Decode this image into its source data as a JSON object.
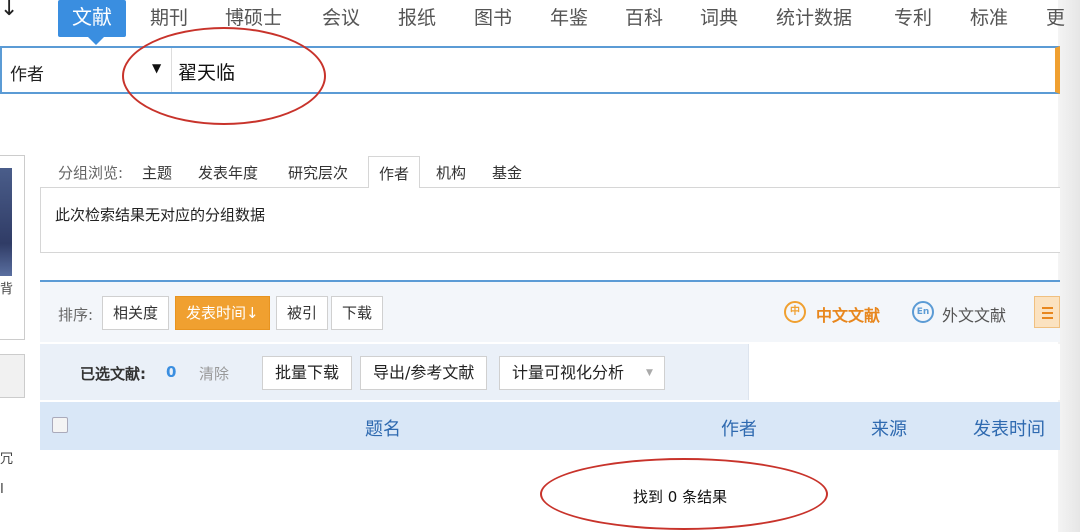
{
  "topnav": {
    "corner": "↓",
    "items": [
      {
        "label": "文献",
        "active": true
      },
      {
        "label": "期刊"
      },
      {
        "label": "博硕士"
      },
      {
        "label": "会议"
      },
      {
        "label": "报纸"
      },
      {
        "label": "图书"
      },
      {
        "label": "年鉴"
      },
      {
        "label": "百科"
      },
      {
        "label": "词典"
      },
      {
        "label": "统计数据"
      },
      {
        "label": "专利"
      },
      {
        "label": "标准"
      },
      {
        "label": "更"
      }
    ]
  },
  "search": {
    "field": "作者",
    "value": "翟天临"
  },
  "left_fragments": {
    "a": "背",
    "b": "冗",
    "c": "I"
  },
  "group": {
    "label": "分组浏览:",
    "tabs": [
      "主题",
      "发表年度",
      "研究层次",
      "作者",
      "机构",
      "基金"
    ],
    "active_tab": "作者",
    "empty_message": "此次检索结果无对应的分组数据"
  },
  "sort": {
    "label": "排序:",
    "options": [
      "相关度",
      "发表时间↓",
      "被引",
      "下载"
    ],
    "active": "发表时间↓"
  },
  "language": {
    "cn_label": "中文文献",
    "en_label": "外文文献",
    "cn_icon": "中",
    "en_icon": "En"
  },
  "selection": {
    "label": "已选文献:",
    "count": "0",
    "clear": "清除",
    "actions": [
      "批量下载",
      "导出/参考文献",
      "计量可视化分析"
    ]
  },
  "table": {
    "headers": [
      "题名",
      "作者",
      "来源",
      "发表时间"
    ]
  },
  "results": {
    "message": "找到 0 条结果"
  },
  "colors": {
    "accent": "#3a8ee0",
    "active_sort": "#f0a030",
    "annotation": "#c8332b"
  }
}
